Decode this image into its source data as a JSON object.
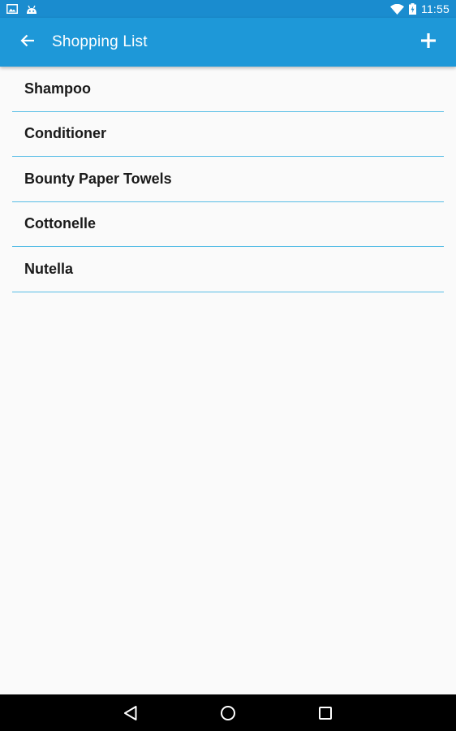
{
  "status_bar": {
    "time": "11:55",
    "left_icons": [
      "image-notification-icon",
      "android-notification-icon"
    ],
    "right_icons": [
      "wifi-icon",
      "battery-charging-icon"
    ]
  },
  "app_bar": {
    "title": "Shopping List",
    "back_icon": "arrow-back-icon",
    "add_icon": "plus-icon",
    "background_color": "#1e98d8"
  },
  "shopping_list": {
    "items": [
      {
        "label": "Shampoo"
      },
      {
        "label": "Conditioner"
      },
      {
        "label": "Bounty Paper Towels"
      },
      {
        "label": "Cottonelle"
      },
      {
        "label": "Nutella"
      }
    ],
    "divider_color": "#57bde6"
  },
  "nav_bar": {
    "buttons": [
      "back-triangle-icon",
      "home-circle-icon",
      "recents-square-icon"
    ]
  }
}
